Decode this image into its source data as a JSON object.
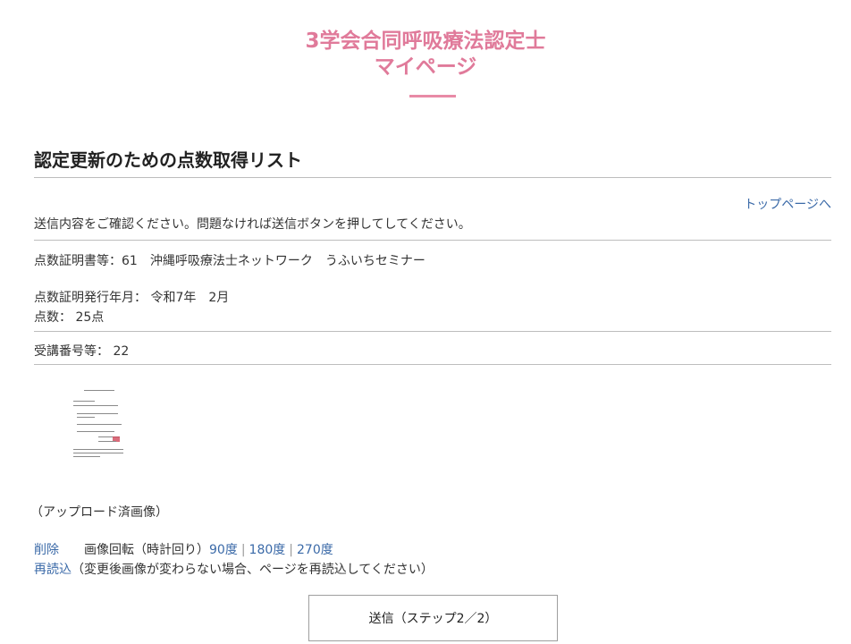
{
  "header": {
    "title_line1": "3学会合同呼吸療法認定士",
    "title_line2": "マイページ"
  },
  "section": {
    "heading": "認定更新のための点数取得リスト",
    "top_link": "トップページへ"
  },
  "confirm_message": "送信内容をご確認ください。問題なければ送信ボタンを押してしてください。",
  "record": {
    "certificate": "点数証明書等：61　沖縄呼吸療法士ネットワーク　うふいちセミナー",
    "issue_date": "点数証明発行年月： 令和7年　2月",
    "points": "点数： 25点",
    "attendance_no": "受講番号等： 22"
  },
  "image": {
    "uploaded_label": "（アップロード済画像）",
    "delete_label": "削除",
    "rotate_label": "画像回転（時計回り）",
    "rotate_options": [
      "90度",
      "180度",
      "270度"
    ],
    "reload_label": "再読込",
    "reload_note": "（変更後画像が変わらない場合、ページを再読込してください）"
  },
  "submit_label": "送信（ステップ2／2）"
}
